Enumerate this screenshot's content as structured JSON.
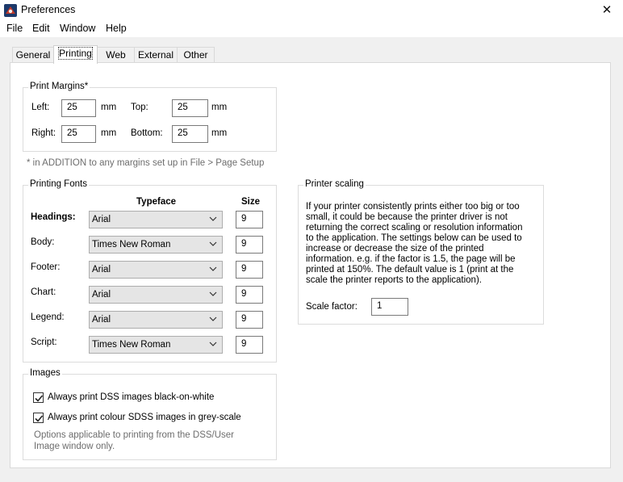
{
  "window": {
    "title": "Preferences",
    "close_glyph": "✕"
  },
  "menu": {
    "items": [
      "File",
      "Edit",
      "Window",
      "Help"
    ]
  },
  "tabs": [
    "General",
    "Printing",
    "Web",
    "External",
    "Other"
  ],
  "active_tab": "Printing",
  "print_margins": {
    "title": "Print Margins*",
    "left_label": "Left:",
    "left_value": "25",
    "right_label": "Right:",
    "right_value": "25",
    "top_label": "Top:",
    "top_value": "25",
    "bottom_label": "Bottom:",
    "bottom_value": "25",
    "unit": "mm",
    "footnote": "* in ADDITION to any margins set up in File > Page Setup"
  },
  "printing_fonts": {
    "title": "Printing Fonts",
    "typeface_header": "Typeface",
    "size_header": "Size",
    "rows": [
      {
        "label": "Headings:",
        "typeface": "Arial",
        "size": "9"
      },
      {
        "label": "Body:",
        "typeface": "Times New Roman",
        "size": "9"
      },
      {
        "label": "Footer:",
        "typeface": "Arial",
        "size": "9"
      },
      {
        "label": "Chart:",
        "typeface": "Arial",
        "size": "9"
      },
      {
        "label": "Legend:",
        "typeface": "Arial",
        "size": "9"
      },
      {
        "label": "Script:",
        "typeface": "Times New Roman",
        "size": "9"
      }
    ]
  },
  "images": {
    "title": "Images",
    "option1": "Always print DSS images black-on-white",
    "option1_checked": true,
    "option2": "Always print colour SDSS images in grey-scale",
    "option2_checked": true,
    "note_line1": "Options applicable to printing from the DSS/User",
    "note_line2": "Image window only."
  },
  "printer_scaling": {
    "title": "Printer scaling",
    "lines": [
      "If your printer consistently prints either too big or too",
      "small, it could be because the printer driver is not",
      "returning the correct scaling or resolution information",
      "to the application. The settings below can be used to",
      "increase or decrease the size of the printed",
      "information. e.g. if the factor is 1.5, the page will be",
      "printed at 150%. The default value is 1 (print at the",
      "scale the printer reports to the application)."
    ],
    "scale_label": "Scale factor:",
    "scale_value": "1"
  },
  "icons": {
    "app": "app-logo-icon",
    "close": "close-icon",
    "dropdown": "chevron-down-icon",
    "check": "checkmark-icon"
  }
}
